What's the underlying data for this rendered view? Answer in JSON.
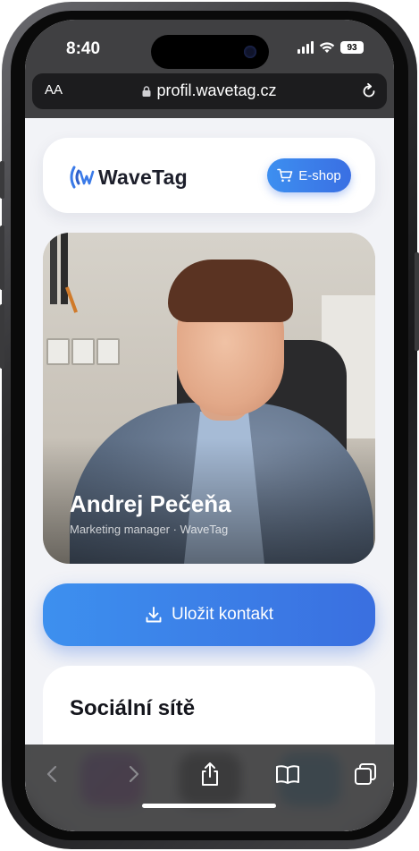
{
  "status_bar": {
    "time": "8:40",
    "battery": "93"
  },
  "browser": {
    "text_size_label": "AA",
    "url": "profil.wavetag.cz"
  },
  "header": {
    "brand": "WaveTag",
    "eshop_label": "E-shop"
  },
  "profile": {
    "name": "Andrej Pečeňa",
    "role": "Marketing manager · WaveTag"
  },
  "actions": {
    "save_contact_label": "Uložit kontakt"
  },
  "social": {
    "title": "Sociální sítě"
  },
  "colors": {
    "accent": "#3a7ae8",
    "page_bg": "#f2f3f7"
  }
}
